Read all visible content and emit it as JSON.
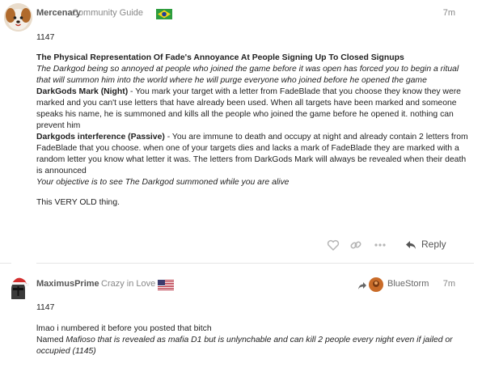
{
  "posts": [
    {
      "username": "Mercenary",
      "user_title": "Community Guide",
      "flag_icon": "brazil-flag-icon",
      "time": "7m",
      "post_number": "1147",
      "heading": "The Physical Representation Of Fade's Annoyance At People Signing Up To Closed Signups",
      "intro": "The Darkgod being so annoyed at people who joined the game before it was open has forced you to begin a ritual that will summon him into the world where he will purge everyone who joined before he opened the game",
      "ability1_name": "DarkGods Mark (Night)",
      "ability1_text": " - You mark your target with a letter from FadeBlade that you choose they know they were marked and you can't use letters that have already been used. When all targets have been marked and someone speaks his name, he is summoned and kills all the people who joined the game before he opened it. nothing can prevent him",
      "ability2_name": "Darkgods interference (Passive)",
      "ability2_text": " - You are immune to death and occupy at night and already contain 2 letters from FadeBlade that you choose. when one of your targets dies and lacks a mark of FadeBlade they are marked with a random letter you know what letter it was. The letters from DarkGods Mark will always be revealed when their death is announced",
      "objective": "Your objective is to see The Darkgod summoned while you are alive",
      "closing": "This VERY OLD thing.",
      "reply_label": "Reply"
    },
    {
      "username": "MaximusPrime",
      "user_title": "Crazy in Love",
      "flag_icon": "usa-flag-icon",
      "reply_to_user": "BlueStorm",
      "time": "7m",
      "post_number": "1147",
      "line1": "lmao i numbered it before you posted that bitch",
      "line2_prefix": "Named ",
      "line2_italic": "Mafioso that is revealed as mafia D1 but is unlynchable and can kill 2 people every night even if jailed or occupied (1145)"
    }
  ],
  "colors": {
    "meta_text": "#888888",
    "username": "#555555",
    "icon": "#b5b5b5"
  }
}
